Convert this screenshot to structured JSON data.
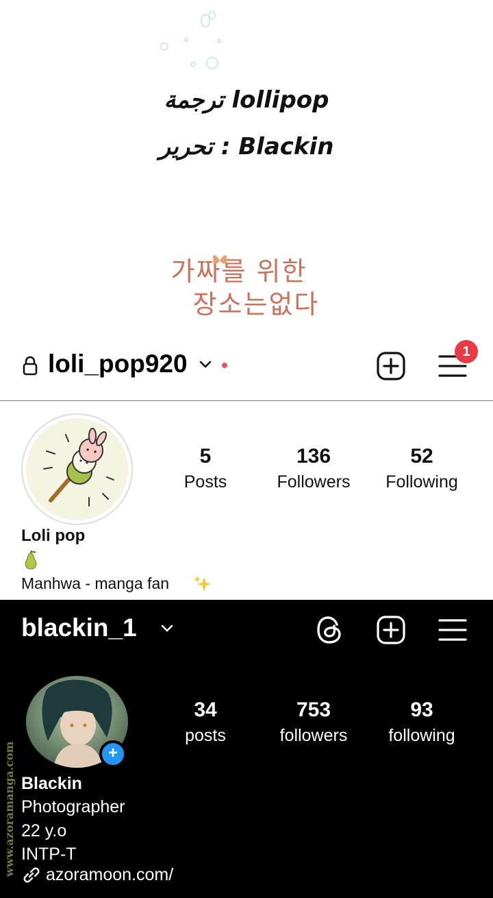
{
  "credits": {
    "line1": "ترجمة lollipop",
    "line2": "تحرير : Blackin",
    "title_art": {
      "line1": "가짜를 위한",
      "line2": "장소는없다"
    }
  },
  "light_profile": {
    "username": "loli_pop920",
    "notification_count": "1",
    "stats": [
      {
        "value": "5",
        "label": "Posts"
      },
      {
        "value": "136",
        "label": "Followers"
      },
      {
        "value": "52",
        "label": "Following"
      }
    ],
    "name": "Loli pop",
    "bio": "Manhwa - manga fan",
    "icons": {
      "lock": "lock-icon",
      "pear": "pear-icon",
      "sparkles": "sparkles-icon"
    }
  },
  "dark_profile": {
    "username": "blackin_1",
    "stats": [
      {
        "value": "34",
        "label": "posts"
      },
      {
        "value": "753",
        "label": "followers"
      },
      {
        "value": "93",
        "label": "following"
      }
    ],
    "name": "Blackin",
    "bio_lines": [
      "Photographer",
      "22 y.o",
      "INTP-T"
    ],
    "link": "azoramoon.com/",
    "story_add": "+"
  },
  "watermark": "www.azoramanga.com",
  "colors": {
    "badge_red": "#e73c45",
    "story_blue": "#2196f3",
    "title_art": "#c9735a"
  }
}
